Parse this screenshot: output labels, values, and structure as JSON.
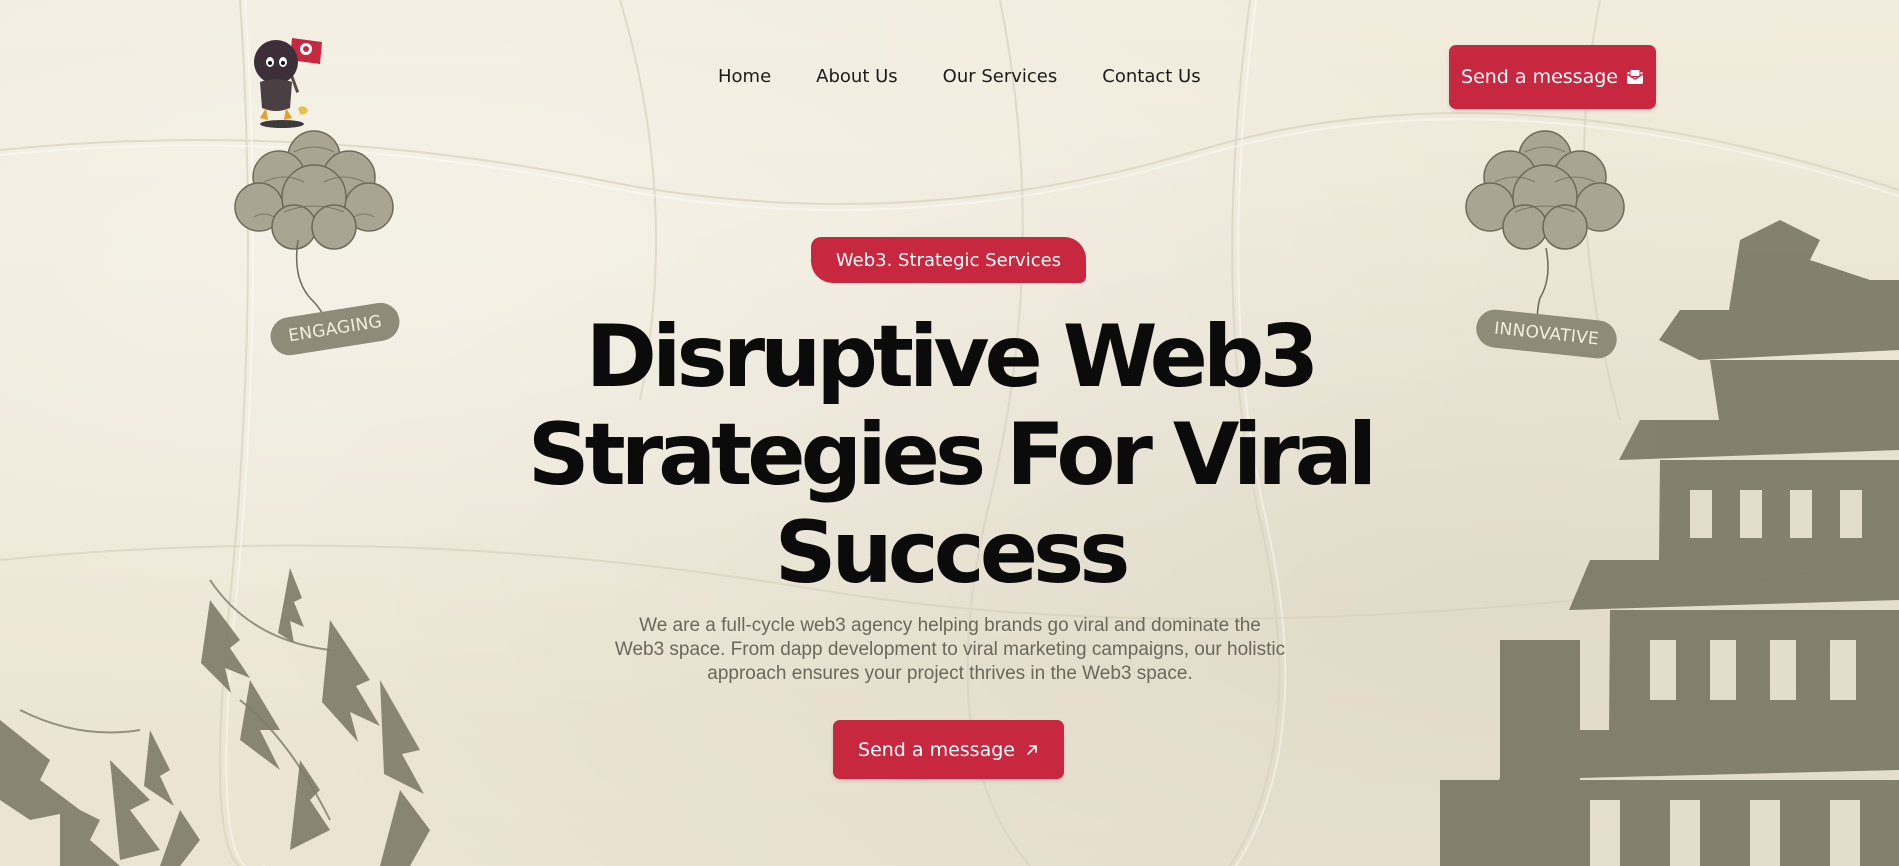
{
  "nav": {
    "items": [
      {
        "label": "Home"
      },
      {
        "label": "About Us"
      },
      {
        "label": "Our Services"
      },
      {
        "label": "Contact Us"
      }
    ]
  },
  "header": {
    "cta_label": "Send a message"
  },
  "tags": {
    "left": "ENGAGING",
    "right": "INNOVATIVE"
  },
  "hero": {
    "badge": "Web3. Strategic Services",
    "title": "Disruptive Web3 Strategies For Viral Success",
    "description": "We are a full-cycle web3 agency helping brands go viral and dominate the Web3 space. From dapp development to viral marketing campaigns, our holistic approach ensures your project thrives in the Web3 space.",
    "cta_label": "Send a message"
  },
  "icons": {
    "header_cta": "envelope-icon",
    "hero_cta": "arrow-up-right-icon",
    "mascot": "ninja-mascot-icon"
  },
  "colors": {
    "accent": "#c8283f",
    "background": "#eee8d8",
    "tag": "#8f8b79",
    "ink": "#0b0b0b",
    "muted": "#6c675d",
    "sketch": "#7e7b6b"
  }
}
